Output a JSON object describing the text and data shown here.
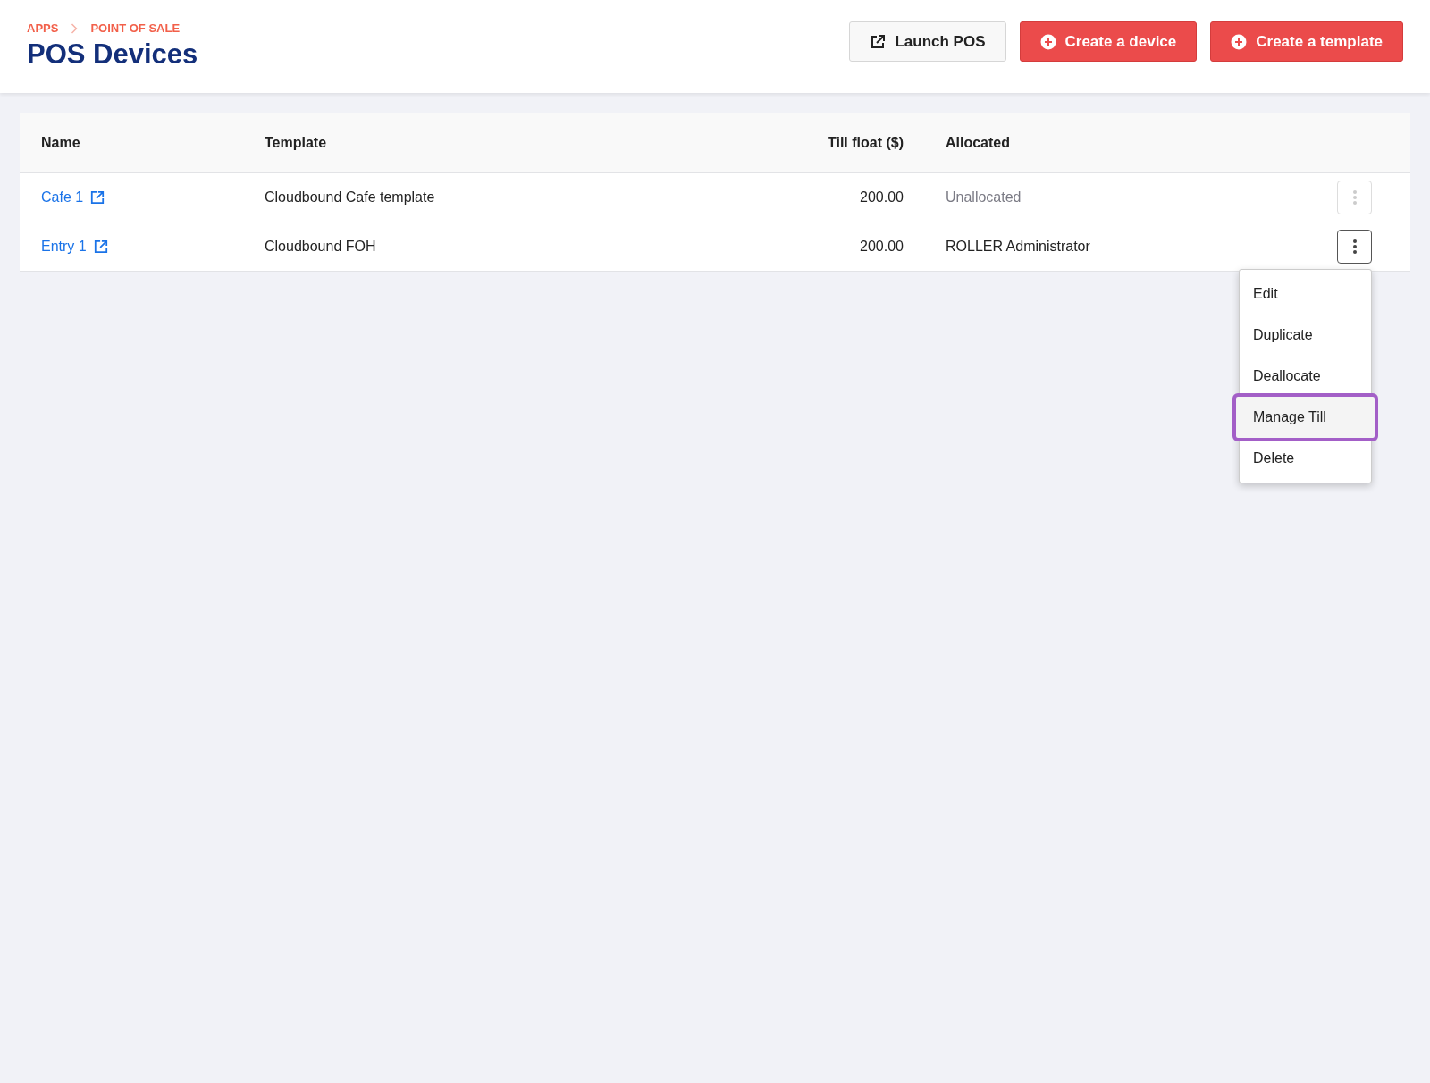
{
  "breadcrumb": [
    "APPS",
    "POINT OF SALE"
  ],
  "title": "POS Devices",
  "actions": [
    {
      "label": "Launch POS",
      "kind": "launch"
    },
    {
      "label": "Create a device",
      "kind": "create"
    },
    {
      "label": "Create a template",
      "kind": "create"
    }
  ],
  "table": {
    "columns": [
      "Name",
      "Template",
      "Till float ($)",
      "Allocated"
    ],
    "rows": [
      {
        "name": "Cafe 1",
        "template": "Cloudbound Cafe template",
        "till_float": "200.00",
        "allocated_to": "Unallocated",
        "allocated": false,
        "menu_open": false
      },
      {
        "name": "Entry 1",
        "template": "Cloudbound FOH",
        "till_float": "200.00",
        "allocated_to": "ROLLER Administrator",
        "allocated": true,
        "menu_open": true
      }
    ]
  },
  "menu": {
    "items": [
      {
        "label": "Edit",
        "selected": false
      },
      {
        "label": "Duplicate",
        "selected": false
      },
      {
        "label": "Deallocate",
        "selected": false
      },
      {
        "label": "Manage Till",
        "selected": true
      },
      {
        "label": "Delete",
        "selected": false
      }
    ]
  }
}
